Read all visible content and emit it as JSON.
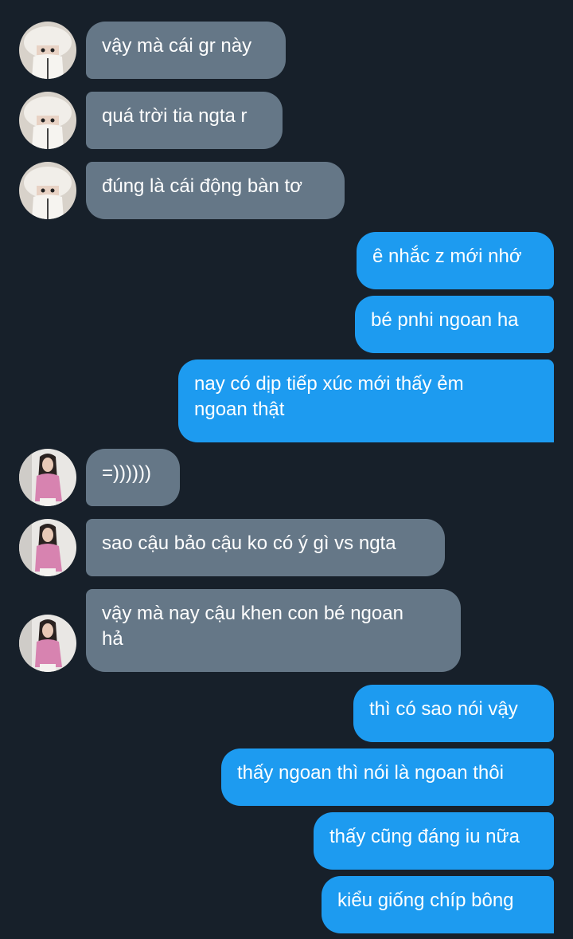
{
  "conversation": {
    "messages": [
      {
        "text": "vậy mà cái gr này"
      },
      {
        "text": "quá trời tia ngta r"
      },
      {
        "text": "đúng là cái động bàn tơ"
      },
      {
        "text": "ê nhắc z mới nhớ"
      },
      {
        "text": "bé pnhi ngoan ha"
      },
      {
        "text": "nay có dịp tiếp xúc mới thấy ẻm\nngoan thật"
      },
      {
        "text": "=))))))"
      },
      {
        "text": "sao cậu bảo cậu ko có ý gì vs ngta"
      },
      {
        "text": "vậy mà nay cậu khen con bé ngoan\nhả"
      },
      {
        "text": "thì có sao nói vậy"
      },
      {
        "text": "thấy ngoan thì nói là ngoan thôi"
      },
      {
        "text": "thấy cũng đáng iu nữa"
      },
      {
        "text": "kiểu giống chíp bông"
      }
    ]
  },
  "colors": {
    "background": "#17202a",
    "incoming_bubble": "#657787",
    "outgoing_bubble": "#1d9bf0",
    "text": "#ffffff"
  },
  "icons": {
    "avatar_1": "user-avatar-white-hat-photo",
    "avatar_2": "user-avatar-pink-outfit-photo"
  }
}
